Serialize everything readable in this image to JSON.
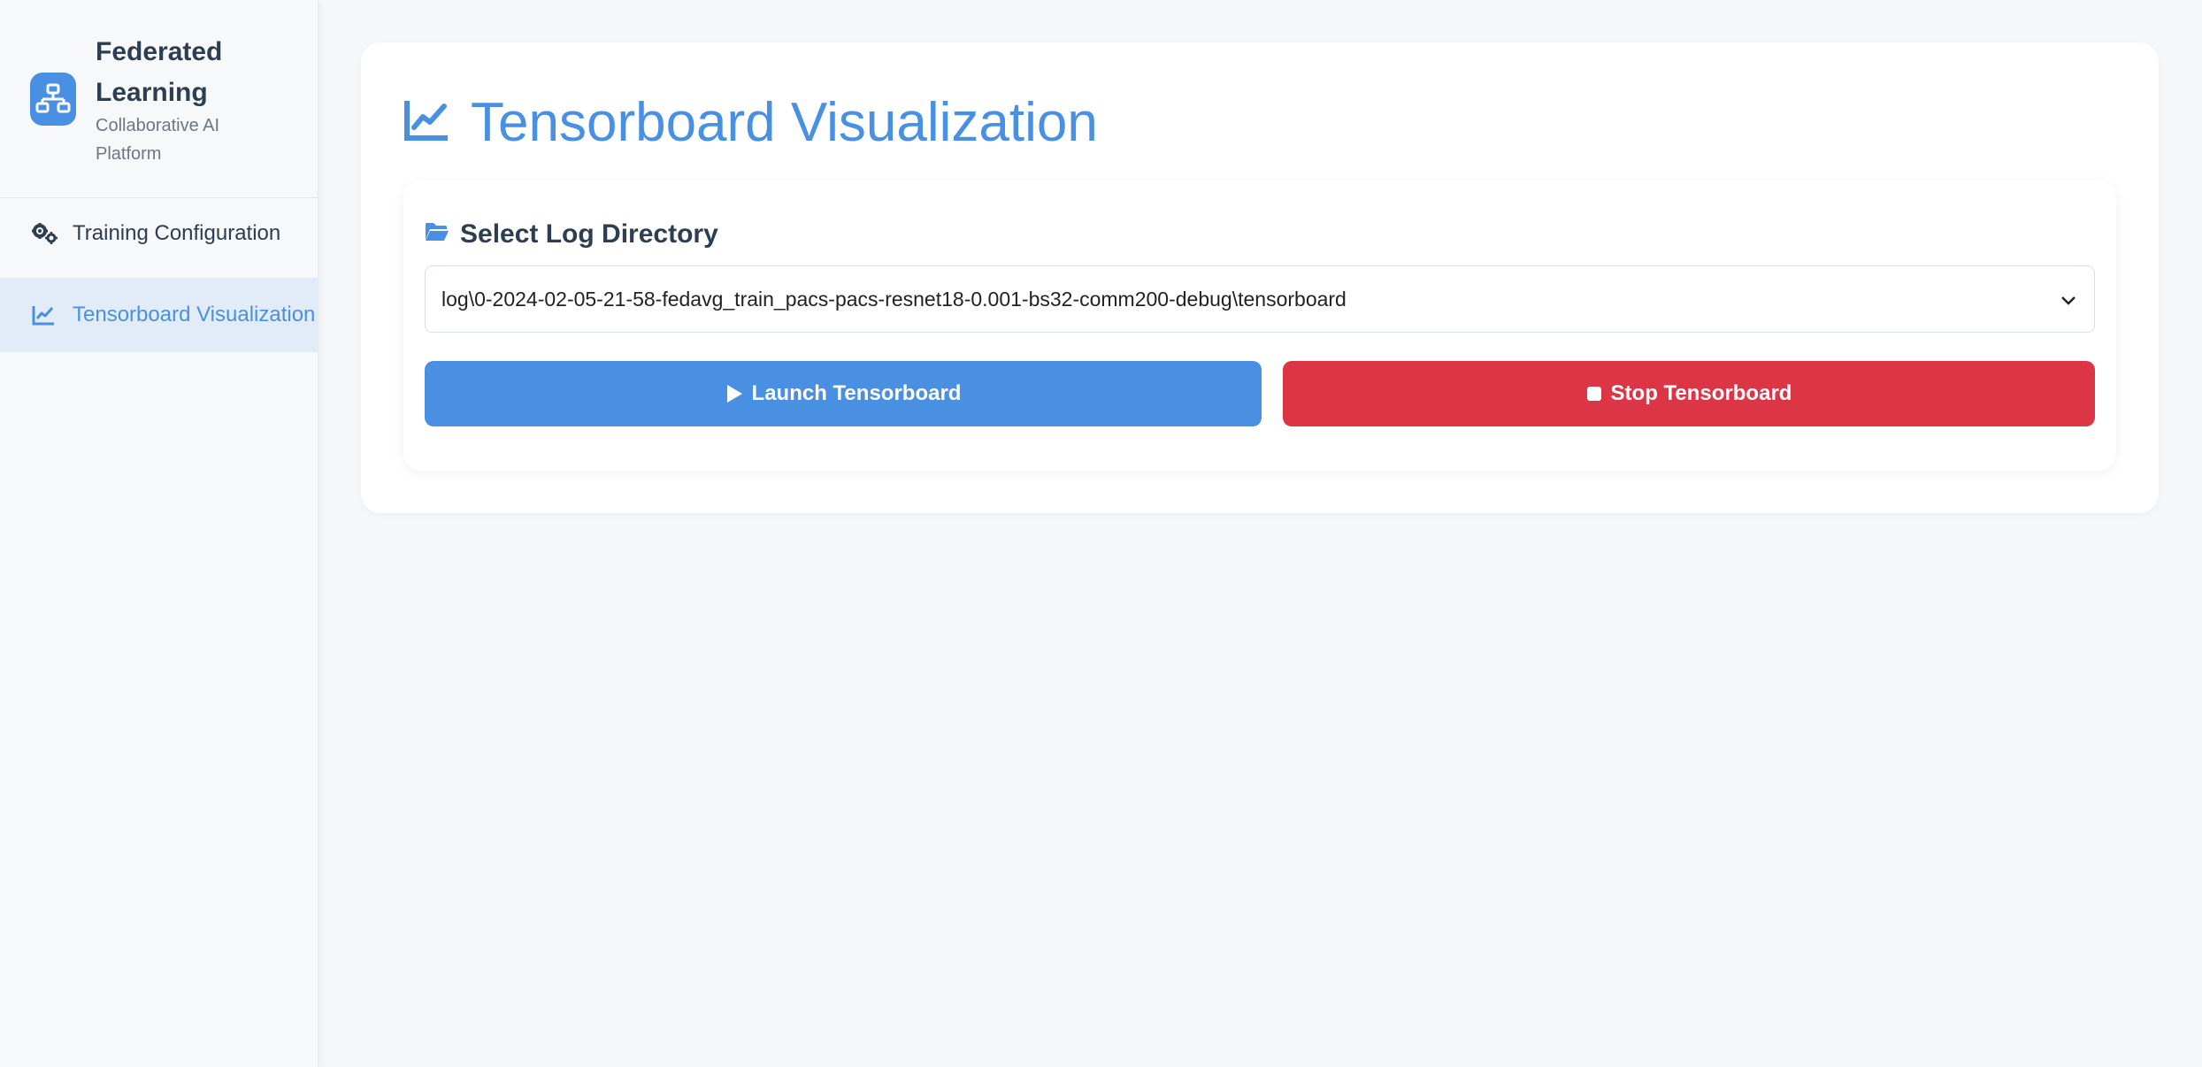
{
  "sidebar": {
    "brand": {
      "title": "Federated Learning",
      "subtitle": "Collaborative AI Platform",
      "icon": "network-icon"
    },
    "items": [
      {
        "label": "Training Configuration",
        "icon": "gears-icon",
        "active": false
      },
      {
        "label": "Tensorboard Visualization",
        "icon": "chart-line-icon",
        "active": true
      }
    ]
  },
  "main": {
    "title": "Tensorboard Visualization",
    "title_icon": "chart-line-icon",
    "panel": {
      "header": "Select Log Directory",
      "header_icon": "folder-open-icon",
      "select_value": "log\\0-2024-02-05-21-58-fedavg_train_pacs-pacs-resnet18-0.001-bs32-comm200-debug\\tensorboard"
    },
    "buttons": {
      "launch_label": "Launch Tensorboard",
      "stop_label": "Stop Tensorboard"
    }
  },
  "colors": {
    "accent": "#4a90e2",
    "danger": "#dc3545",
    "text_dark": "#2c3e50",
    "sidebar_active_bg": "#e1ecf8"
  }
}
